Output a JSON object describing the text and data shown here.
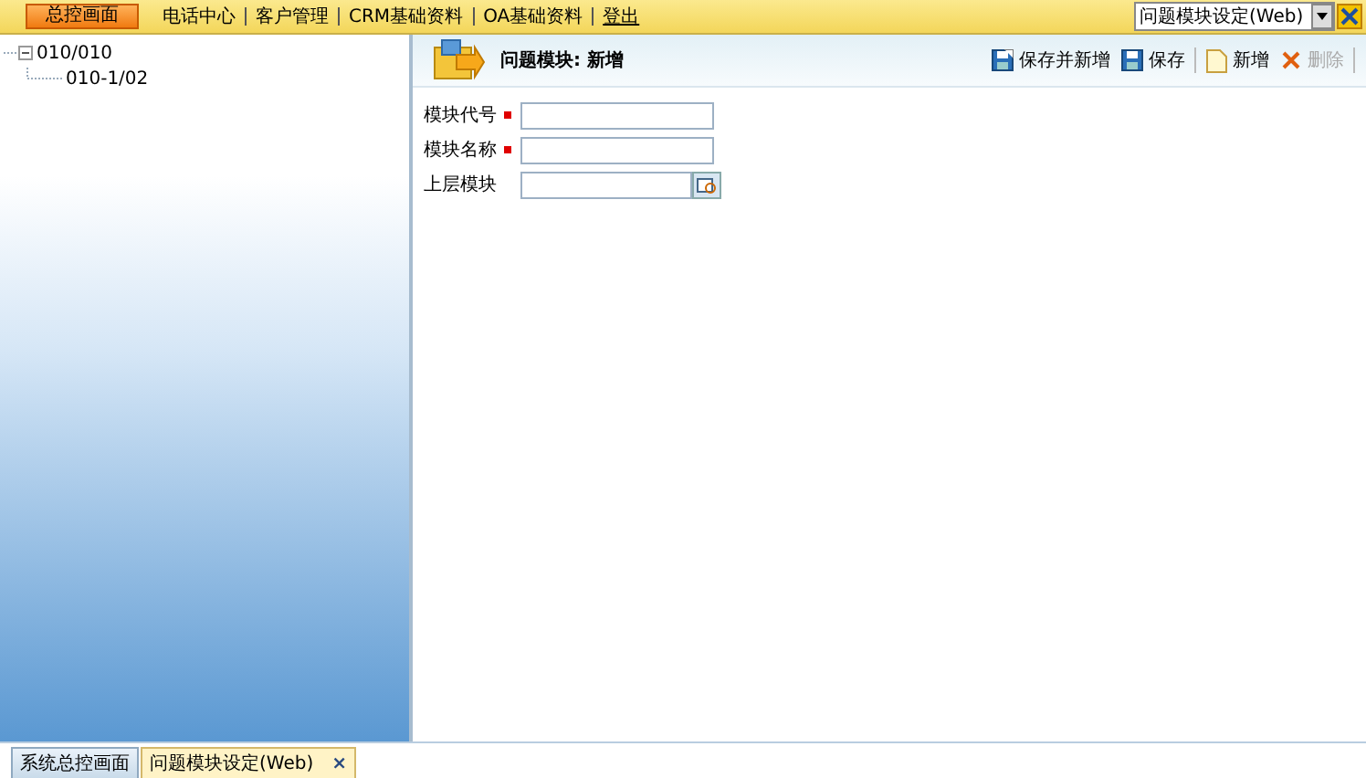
{
  "top_menu": {
    "home_button": "总控画面",
    "items": [
      "电话中心",
      "客户管理",
      "CRM基础资料",
      "OA基础资料",
      "登出"
    ],
    "window_select": {
      "value": "问题模块设定(Web)"
    }
  },
  "tree": [
    {
      "label": "010/010",
      "expanded": true,
      "children": [
        {
          "label": "010-1/02"
        }
      ]
    }
  ],
  "header": {
    "title": "问题模块: 新增"
  },
  "toolbar": [
    {
      "label": "保存并新增",
      "kind": "save-new",
      "disabled": false
    },
    {
      "label": "保存",
      "kind": "save",
      "disabled": false
    },
    {
      "label": "新增",
      "kind": "new",
      "disabled": false
    },
    {
      "label": "删除",
      "kind": "delete",
      "disabled": true
    }
  ],
  "form": [
    {
      "label": "模块代号",
      "required": true,
      "kind": "text"
    },
    {
      "label": "模块名称",
      "required": true,
      "kind": "text"
    },
    {
      "label": "上层模块",
      "required": false,
      "kind": "lookup"
    }
  ],
  "bottom_tabs": [
    {
      "label": "系统总控画面",
      "selected": false,
      "closable": false
    },
    {
      "label": "问题模块设定(Web)",
      "selected": true,
      "closable": true,
      "close": "×"
    }
  ]
}
